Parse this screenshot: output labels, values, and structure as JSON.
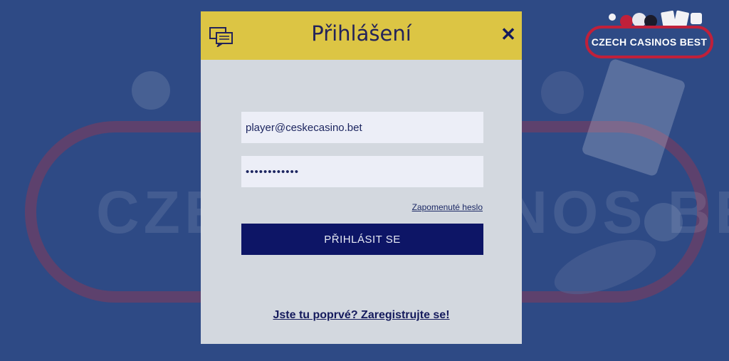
{
  "background": {
    "watermark_text": "CZECH CASINOS BEST",
    "color": "#2e4a85"
  },
  "logo": {
    "text": "CZECH CASINOS BEST",
    "border_color": "#c0203a"
  },
  "modal": {
    "header_color": "#dcc544",
    "title": "Přihlášení",
    "chat_icon": "chat-icon",
    "close_icon": "close-icon",
    "close_glyph": "✕",
    "email_value": "player@ceskecasino.bet",
    "password_value": "••••••••••••",
    "forgot_link": "Zapomenuté heslo",
    "login_button": "PŘIHLÁSIT SE",
    "button_color": "#0d1566",
    "register_link": "Jste tu poprvé? Zaregistrujte se!"
  }
}
